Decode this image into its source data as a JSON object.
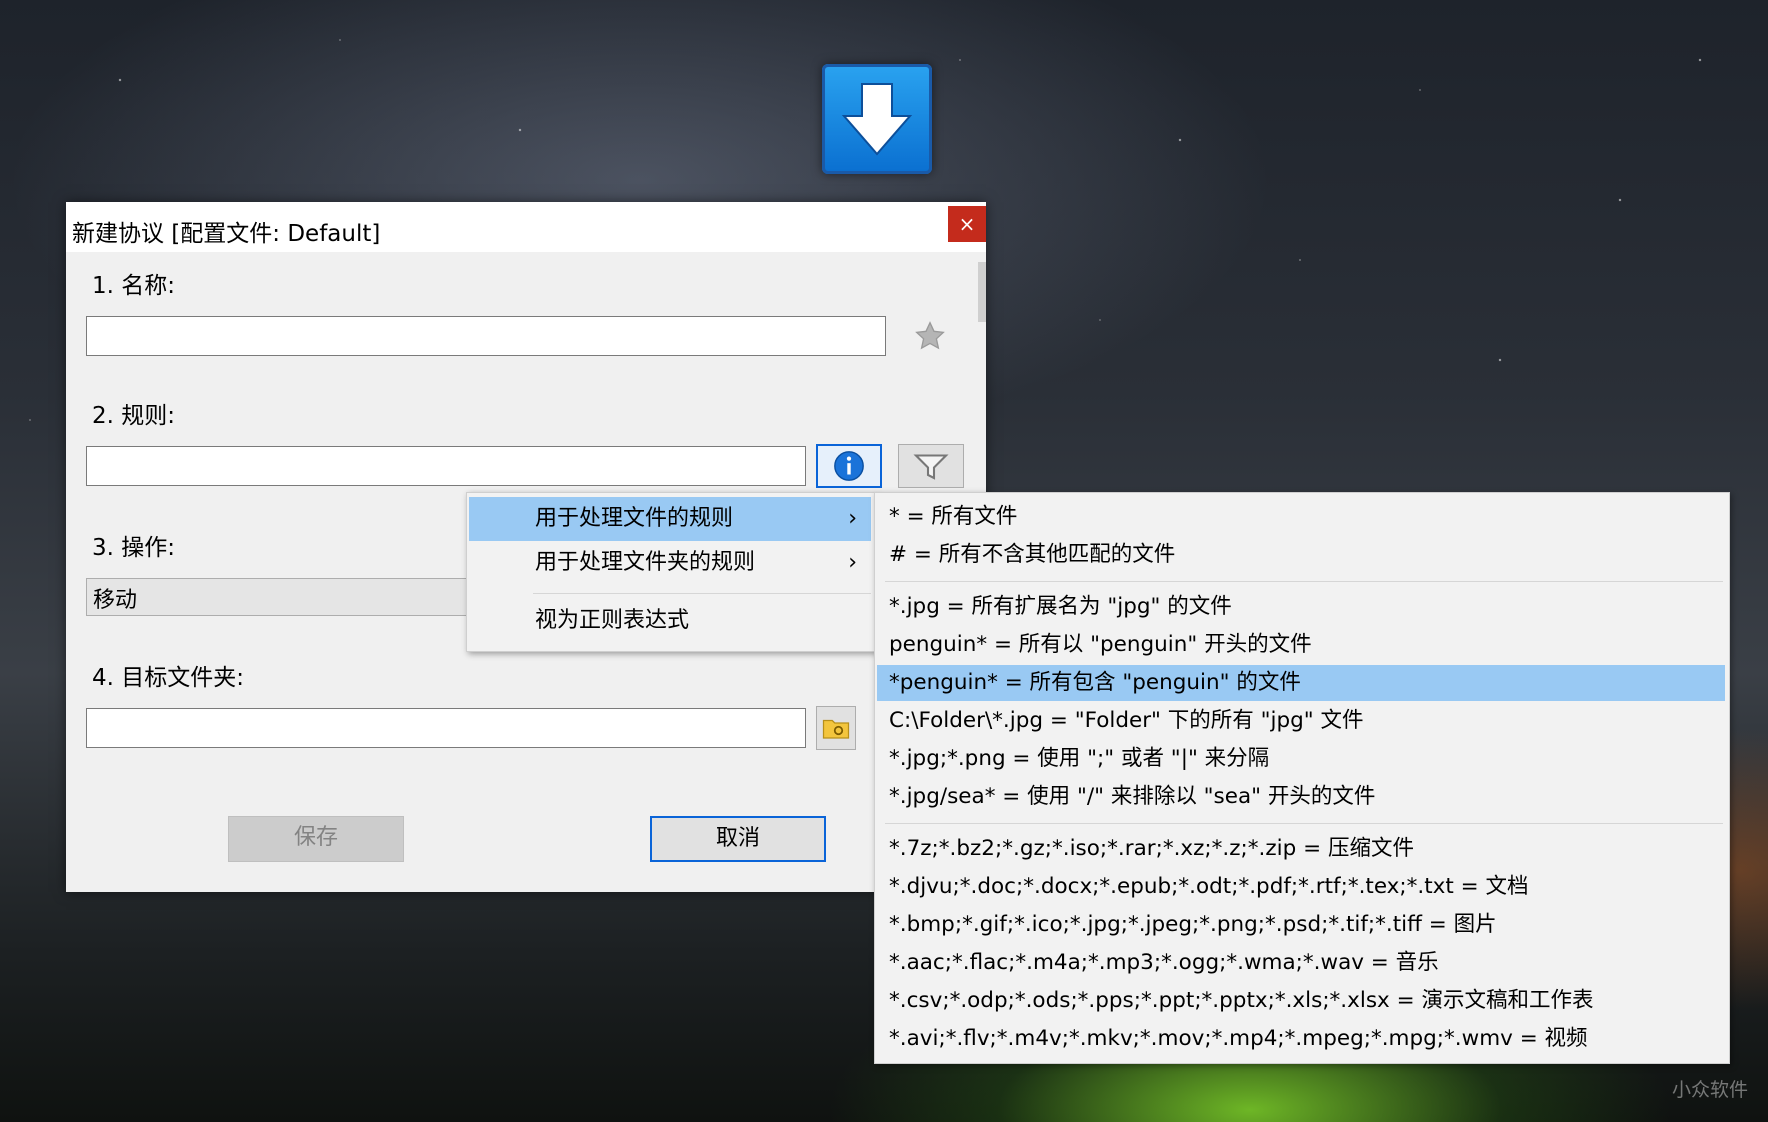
{
  "dialog": {
    "title": "新建协议 [配置文件: Default]",
    "close_label": "×",
    "name_label": "1. 名称:",
    "name_value": "",
    "rule_label": "2. 规则:",
    "rule_value": "",
    "action_label": "3. 操作:",
    "action_value": "移动",
    "target_label": "4. 目标文件夹:",
    "target_value": "",
    "save_label": "保存",
    "cancel_label": "取消"
  },
  "rule_menu": {
    "items": [
      {
        "label": "用于处理文件的规则",
        "arrow": "›"
      },
      {
        "label": "用于处理文件夹的规则",
        "arrow": "›"
      },
      {
        "label": "视为正则表达式"
      }
    ]
  },
  "file_rules_submenu": {
    "groups": [
      [
        "* = 所有文件",
        "# = 所有不含其他匹配的文件"
      ],
      [
        "*.jpg = 所有扩展名为 \"jpg\" 的文件",
        "penguin* = 所有以 \"penguin\" 开头的文件",
        "*penguin* = 所有包含 \"penguin\" 的文件",
        "C:\\Folder\\*.jpg = \"Folder\" 下的所有 \"jpg\" 文件",
        "*.jpg;*.png = 使用 \";\" 或者 \"|\" 来分隔",
        "*.jpg/sea* = 使用 \"/\" 来排除以 \"sea\" 开头的文件"
      ],
      [
        "*.7z;*.bz2;*.gz;*.iso;*.rar;*.xz;*.z;*.zip = 压缩文件",
        "*.djvu;*.doc;*.docx;*.epub;*.odt;*.pdf;*.rtf;*.tex;*.txt = 文档",
        "*.bmp;*.gif;*.ico;*.jpg;*.jpeg;*.png;*.psd;*.tif;*.tiff = 图片",
        "*.aac;*.flac;*.m4a;*.mp3;*.ogg;*.wma;*.wav = 音乐",
        "*.csv;*.odp;*.ods;*.pps;*.ppt;*.pptx;*.xls;*.xlsx = 演示文稿和工作表",
        "*.avi;*.flv;*.m4v;*.mkv;*.mov;*.mp4;*.mpeg;*.mpg;*.wmv = 视频"
      ]
    ]
  },
  "watermark": "小众软件",
  "icons": [
    "download-arrow-icon",
    "close-icon",
    "star-icon",
    "info-icon",
    "filter-icon",
    "folder-icon",
    "chevron-right-icon"
  ],
  "colors": {
    "accent": "#0a64d8",
    "highlight": "#99c9f3",
    "close": "#c42b1c"
  }
}
